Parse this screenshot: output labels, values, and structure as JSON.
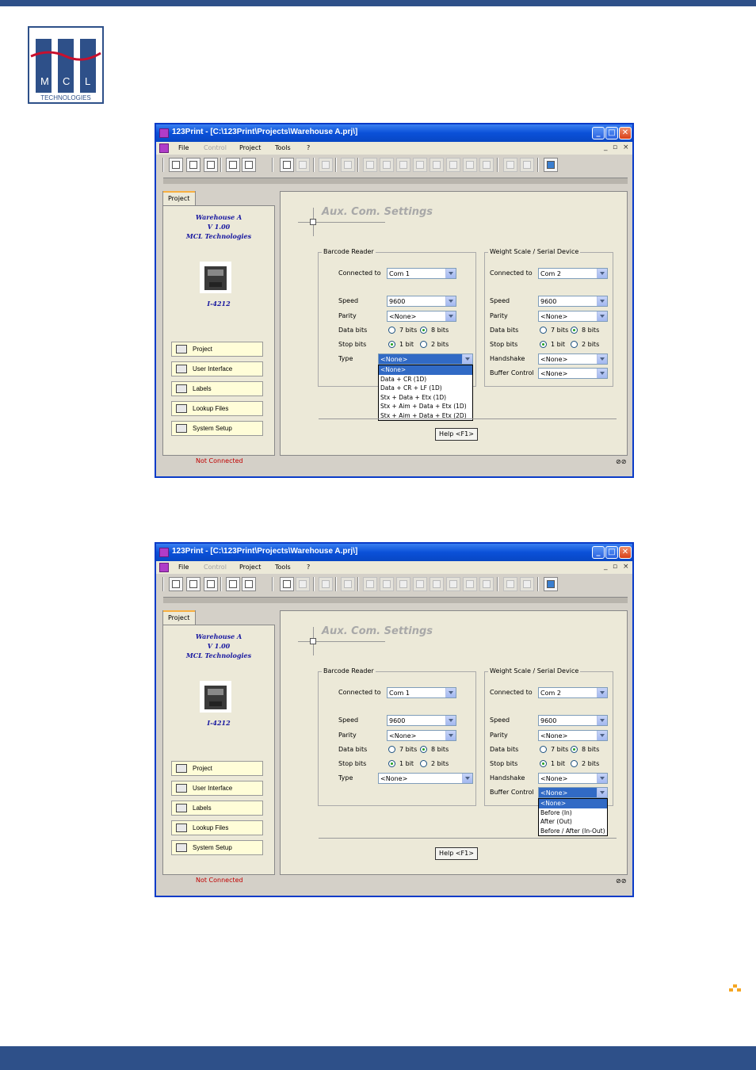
{
  "windows": [
    {
      "title": "123Print - [C:\\123Print\\Projects\\Warehouse A.prj\\]",
      "menu": [
        "File",
        "Control",
        "Project",
        "Tools",
        "?"
      ],
      "project_tab": "Project",
      "project_name": "Warehouse A",
      "project_version": "V 1.00",
      "project_company": "MCL Technologies",
      "printer_model": "I-4212",
      "nav": [
        "Project",
        "User Interface",
        "Labels",
        "Lookup Files",
        "System Setup"
      ],
      "status": "Not Connected",
      "status_right": "⊘⊘",
      "section_title": "Aux. Com. Settings",
      "barcode": {
        "legend": "Barcode Reader",
        "connected_label": "Connected to",
        "connected_value": "Com 1",
        "speed_label": "Speed",
        "speed_value": "9600",
        "parity_label": "Parity",
        "parity_value": "<None>",
        "databits_label": "Data bits",
        "databits_opt1": "7 bits",
        "databits_opt2": "8 bits",
        "stopbits_label": "Stop bits",
        "stopbits_opt1": "1 bit",
        "stopbits_opt2": "2 bits",
        "type_label": "Type",
        "type_value": "<None>"
      },
      "scale": {
        "legend": "Weight Scale / Serial Device",
        "connected_label": "Connected to",
        "connected_value": "Com 2",
        "speed_label": "Speed",
        "speed_value": "9600",
        "parity_label": "Parity",
        "parity_value": "<None>",
        "databits_label": "Data bits",
        "databits_opt1": "7 bits",
        "databits_opt2": "8 bits",
        "stopbits_label": "Stop bits",
        "stopbits_opt1": "1 bit",
        "stopbits_opt2": "2 bits",
        "handshake_label": "Handshake",
        "handshake_value": "<None>",
        "buffer_label": "Buffer Control",
        "buffer_value": "<None>"
      },
      "open_list": [
        "<None>",
        "Data + CR (1D)",
        "Data + CR + LF (1D)",
        "Stx + Data + Etx (1D)",
        "Stx + Aim + Data + Etx (1D)",
        "Stx + Aim + Data + Etx (2D)"
      ],
      "help": "Help <F1>"
    },
    {
      "title": "123Print - [C:\\123Print\\Projects\\Warehouse A.prj\\]",
      "menu": [
        "File",
        "Control",
        "Project",
        "Tools",
        "?"
      ],
      "project_tab": "Project",
      "project_name": "Warehouse A",
      "project_version": "V 1.00",
      "project_company": "MCL Technologies",
      "printer_model": "I-4212",
      "nav": [
        "Project",
        "User Interface",
        "Labels",
        "Lookup Files",
        "System Setup"
      ],
      "status": "Not Connected",
      "status_right": "⊘⊘",
      "section_title": "Aux. Com. Settings",
      "barcode": {
        "legend": "Barcode Reader",
        "connected_label": "Connected to",
        "connected_value": "Com 1",
        "speed_label": "Speed",
        "speed_value": "9600",
        "parity_label": "Parity",
        "parity_value": "<None>",
        "databits_label": "Data bits",
        "databits_opt1": "7 bits",
        "databits_opt2": "8 bits",
        "stopbits_label": "Stop bits",
        "stopbits_opt1": "1 bit",
        "stopbits_opt2": "2 bits",
        "type_label": "Type",
        "type_value": "<None>"
      },
      "scale": {
        "legend": "Weight Scale / Serial Device",
        "connected_label": "Connected to",
        "connected_value": "Com 2",
        "speed_label": "Speed",
        "speed_value": "9600",
        "parity_label": "Parity",
        "parity_value": "<None>",
        "databits_label": "Data bits",
        "databits_opt1": "7 bits",
        "databits_opt2": "8 bits",
        "stopbits_label": "Stop bits",
        "stopbits_opt1": "1 bit",
        "stopbits_opt2": "2 bits",
        "handshake_label": "Handshake",
        "handshake_value": "<None>",
        "buffer_label": "Buffer Control",
        "buffer_value": "<None>"
      },
      "open_list": [
        "<None>",
        "Before (In)",
        "After (Out)",
        "Before / After (In-Out)"
      ],
      "help": "Help <F1>"
    }
  ],
  "logo": {
    "text": "MCL",
    "subtext": "TECHNOLOGIES"
  },
  "colors": {
    "brand": "#2e5089",
    "accent_red": "#c8102e",
    "page_mark": "#f5a623"
  }
}
